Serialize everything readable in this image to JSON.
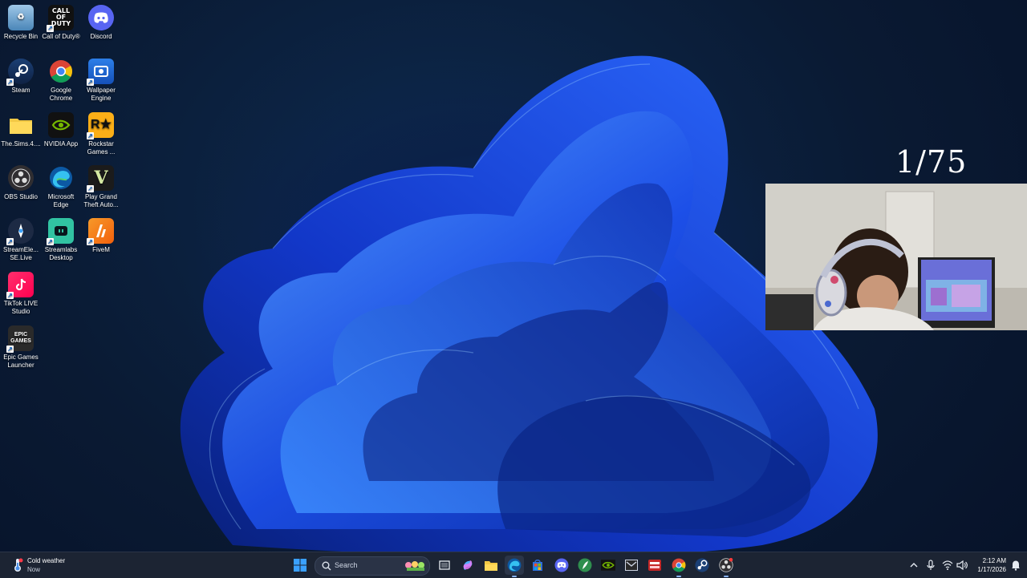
{
  "desktop": {
    "icons": [
      {
        "label": "Recycle Bin",
        "icon": "recycle-bin-icon"
      },
      {
        "label": "Call of Duty®",
        "icon": "call-of-duty-icon"
      },
      {
        "label": "Discord",
        "icon": "discord-icon"
      },
      {
        "label": "Steam",
        "icon": "steam-icon"
      },
      {
        "label": "Google Chrome",
        "icon": "chrome-icon"
      },
      {
        "label": "Wallpaper Engine",
        "icon": "wallpaper-engine-icon"
      },
      {
        "label": "The.Sims.4....",
        "icon": "folder-icon"
      },
      {
        "label": "NVIDIA App",
        "icon": "nvidia-icon"
      },
      {
        "label": "Rockstar Games ...",
        "icon": "rockstar-icon"
      },
      {
        "label": "OBS Studio",
        "icon": "obs-icon"
      },
      {
        "label": "Microsoft Edge",
        "icon": "edge-icon"
      },
      {
        "label": "Play Grand Theft Auto...",
        "icon": "gta-icon"
      },
      {
        "label": "StreamEle... SE.Live",
        "icon": "streamelements-icon"
      },
      {
        "label": "Streamlabs Desktop",
        "icon": "streamlabs-icon"
      },
      {
        "label": "FiveM",
        "icon": "fivem-icon"
      },
      {
        "label": "TikTok LIVE Studio",
        "icon": "tiktok-icon"
      },
      {
        "label": "Epic Games Launcher",
        "icon": "epic-games-icon"
      }
    ],
    "icon_text": {
      "cod": "CALL OF DUTY",
      "epic": "EPIC GAMES"
    }
  },
  "overlay": {
    "counter": "1/75"
  },
  "taskbar": {
    "weather": {
      "title": "Cold weather",
      "subtitle": "Now"
    },
    "search_placeholder": "Search",
    "clock": {
      "time": "2:12 AM",
      "date": "1/17/2026"
    },
    "colors": {
      "background": "#1c2433",
      "accent": "#8ab4f8"
    }
  }
}
